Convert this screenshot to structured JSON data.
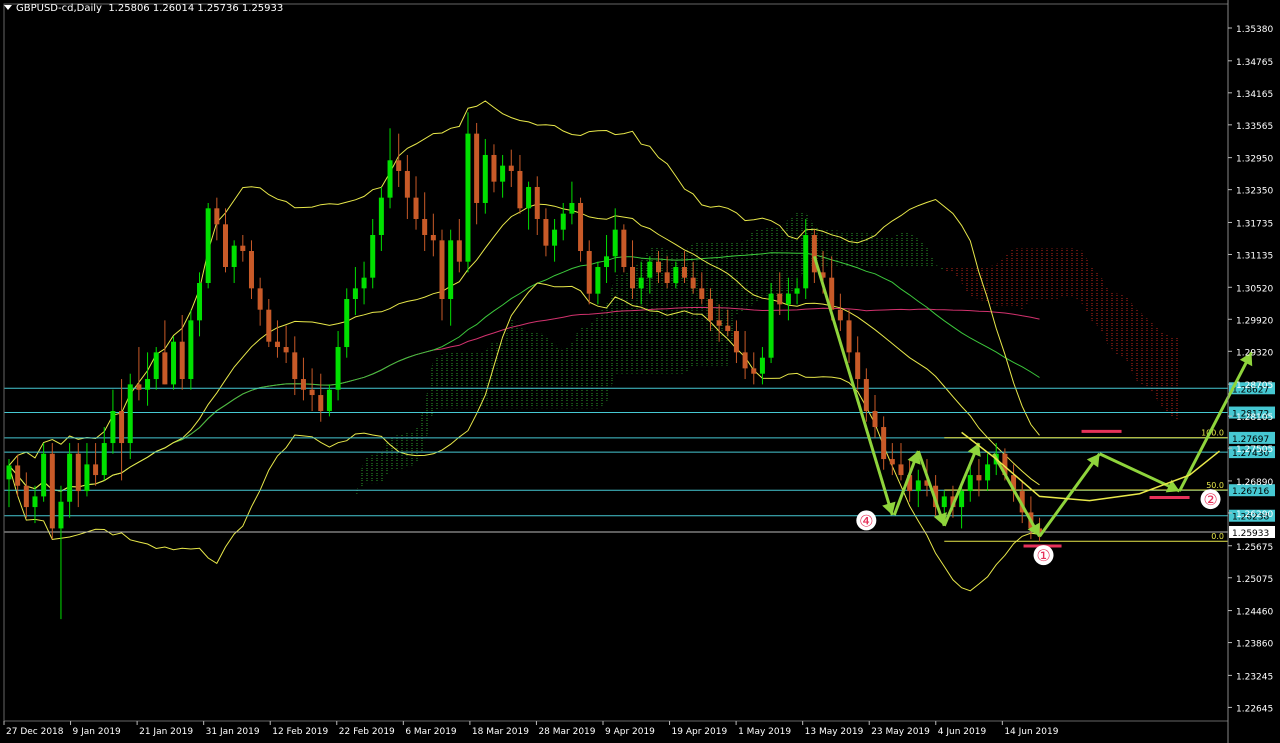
{
  "header": {
    "symbol": "GBPUSD-cd,Daily",
    "ohlc": "1.25806 1.26014 1.25736 1.25933"
  },
  "colors": {
    "background": "#000000",
    "bull_candle": "#00e000",
    "bear_candle": "#c85a28",
    "bollinger": "#e8e84a",
    "kumo_bear": "#c0281e",
    "kumo_bull": "#2ea02e",
    "ma_slow": "#d2326e",
    "ma_fast": "#3cc83c",
    "hline": "#46c8d2",
    "arrow": "#8fd43c",
    "marker": "#e6325a"
  },
  "chart_data": {
    "type": "candlestick",
    "ylim": [
      1.2239,
      1.3568
    ],
    "y_ticks": [
      "1.35380",
      "1.34765",
      "1.34165",
      "1.33565",
      "1.32950",
      "1.32350",
      "1.31735",
      "1.31135",
      "1.30520",
      "1.29920",
      "1.29320",
      "1.28705",
      "1.28105",
      "1.27505",
      "1.26890",
      "1.26290",
      "1.25675",
      "1.25075",
      "1.24460",
      "1.23860",
      "1.23245",
      "1.22645"
    ],
    "x_labels": [
      "27 Dec 2018",
      "9 Jan 2019",
      "21 Jan 2019",
      "31 Jan 2019",
      "12 Feb 2019",
      "22 Feb 2019",
      "6 Mar 2019",
      "18 Mar 2019",
      "28 Mar 2019",
      "9 Apr 2019",
      "19 Apr 2019",
      "1 May 2019",
      "13 May 2019",
      "23 May 2019",
      "4 Jun 2019",
      "14 Jun 2019"
    ],
    "price_levels": [
      "1.28627",
      "1.28172",
      "1.27697",
      "1.27430",
      "1.26716",
      "1.26238",
      "1.25933"
    ],
    "current_price": "1.25933",
    "fib_levels": [
      {
        "label": "100.0",
        "price": 1.277
      },
      {
        "label": "50.0",
        "price": 1.2672
      },
      {
        "label": "0.0",
        "price": 1.2576
      }
    ],
    "wave_labels": [
      "④",
      "①",
      "②"
    ],
    "candles": [
      [
        1.2692,
        1.273,
        1.264,
        1.2718
      ],
      [
        1.2718,
        1.2738,
        1.266,
        1.268
      ],
      [
        1.268,
        1.2705,
        1.262,
        1.264
      ],
      [
        1.264,
        1.268,
        1.261,
        1.266
      ],
      [
        1.266,
        1.276,
        1.265,
        1.274
      ],
      [
        1.274,
        1.276,
        1.258,
        1.26
      ],
      [
        1.26,
        1.268,
        1.243,
        1.265
      ],
      [
        1.265,
        1.276,
        1.262,
        1.274
      ],
      [
        1.274,
        1.276,
        1.264,
        1.267
      ],
      [
        1.267,
        1.276,
        1.266,
        1.272
      ],
      [
        1.272,
        1.276,
        1.268,
        1.27
      ],
      [
        1.27,
        1.279,
        1.269,
        1.276
      ],
      [
        1.276,
        1.286,
        1.274,
        1.282
      ],
      [
        1.282,
        1.288,
        1.269,
        1.276
      ],
      [
        1.276,
        1.289,
        1.273,
        1.287
      ],
      [
        1.287,
        1.294,
        1.284,
        1.286
      ],
      [
        1.286,
        1.293,
        1.283,
        1.288
      ],
      [
        1.288,
        1.294,
        1.286,
        1.293
      ],
      [
        1.293,
        1.299,
        1.287,
        1.287
      ],
      [
        1.287,
        1.296,
        1.286,
        1.295
      ],
      [
        1.295,
        1.3,
        1.286,
        1.288
      ],
      [
        1.288,
        1.301,
        1.286,
        1.299
      ],
      [
        1.299,
        1.308,
        1.296,
        1.306
      ],
      [
        1.306,
        1.321,
        1.305,
        1.32
      ],
      [
        1.32,
        1.322,
        1.314,
        1.317
      ],
      [
        1.317,
        1.32,
        1.308,
        1.309
      ],
      [
        1.309,
        1.314,
        1.306,
        1.313
      ],
      [
        1.313,
        1.315,
        1.31,
        1.312
      ],
      [
        1.312,
        1.314,
        1.303,
        1.305
      ],
      [
        1.305,
        1.307,
        1.298,
        1.301
      ],
      [
        1.301,
        1.303,
        1.294,
        1.295
      ],
      [
        1.295,
        1.299,
        1.292,
        1.294
      ],
      [
        1.294,
        1.298,
        1.291,
        1.293
      ],
      [
        1.293,
        1.296,
        1.285,
        1.288
      ],
      [
        1.288,
        1.292,
        1.284,
        1.286
      ],
      [
        1.286,
        1.29,
        1.282,
        1.285
      ],
      [
        1.285,
        1.289,
        1.28,
        1.282
      ],
      [
        1.282,
        1.287,
        1.281,
        1.286
      ],
      [
        1.286,
        1.297,
        1.284,
        1.294
      ],
      [
        1.294,
        1.305,
        1.292,
        1.303
      ],
      [
        1.303,
        1.309,
        1.3,
        1.305
      ],
      [
        1.305,
        1.31,
        1.302,
        1.307
      ],
      [
        1.307,
        1.318,
        1.305,
        1.315
      ],
      [
        1.315,
        1.324,
        1.312,
        1.322
      ],
      [
        1.322,
        1.335,
        1.32,
        1.329
      ],
      [
        1.329,
        1.334,
        1.324,
        1.327
      ],
      [
        1.327,
        1.33,
        1.318,
        1.322
      ],
      [
        1.322,
        1.326,
        1.316,
        1.318
      ],
      [
        1.318,
        1.323,
        1.312,
        1.315
      ],
      [
        1.315,
        1.319,
        1.311,
        1.314
      ],
      [
        1.314,
        1.316,
        1.299,
        1.303
      ],
      [
        1.303,
        1.316,
        1.298,
        1.314
      ],
      [
        1.314,
        1.318,
        1.308,
        1.31
      ],
      [
        1.31,
        1.338,
        1.308,
        1.334
      ],
      [
        1.334,
        1.336,
        1.317,
        1.321
      ],
      [
        1.321,
        1.333,
        1.319,
        1.33
      ],
      [
        1.33,
        1.332,
        1.323,
        1.325
      ],
      [
        1.325,
        1.33,
        1.322,
        1.328
      ],
      [
        1.328,
        1.331,
        1.324,
        1.327
      ],
      [
        1.327,
        1.33,
        1.319,
        1.32
      ],
      [
        1.32,
        1.325,
        1.316,
        1.324
      ],
      [
        1.324,
        1.326,
        1.315,
        1.318
      ],
      [
        1.318,
        1.32,
        1.311,
        1.313
      ],
      [
        1.313,
        1.318,
        1.31,
        1.316
      ],
      [
        1.316,
        1.321,
        1.314,
        1.319
      ],
      [
        1.319,
        1.325,
        1.317,
        1.321
      ],
      [
        1.321,
        1.322,
        1.31,
        1.312
      ],
      [
        1.312,
        1.314,
        1.302,
        1.304
      ],
      [
        1.304,
        1.31,
        1.302,
        1.309
      ],
      [
        1.309,
        1.315,
        1.306,
        1.311
      ],
      [
        1.311,
        1.32,
        1.308,
        1.316
      ],
      [
        1.316,
        1.317,
        1.308,
        1.309
      ],
      [
        1.309,
        1.314,
        1.303,
        1.305
      ],
      [
        1.305,
        1.31,
        1.302,
        1.307
      ],
      [
        1.307,
        1.311,
        1.304,
        1.31
      ],
      [
        1.31,
        1.312,
        1.306,
        1.308
      ],
      [
        1.308,
        1.311,
        1.305,
        1.306
      ],
      [
        1.306,
        1.31,
        1.305,
        1.309
      ],
      [
        1.309,
        1.312,
        1.306,
        1.307
      ],
      [
        1.307,
        1.31,
        1.304,
        1.305
      ],
      [
        1.305,
        1.308,
        1.302,
        1.303
      ],
      [
        1.303,
        1.305,
        1.297,
        1.299
      ],
      [
        1.299,
        1.302,
        1.295,
        1.298
      ],
      [
        1.298,
        1.301,
        1.296,
        1.297
      ],
      [
        1.297,
        1.299,
        1.291,
        1.293
      ],
      [
        1.293,
        1.297,
        1.288,
        1.29
      ],
      [
        1.29,
        1.293,
        1.287,
        1.289
      ],
      [
        1.289,
        1.294,
        1.287,
        1.292
      ],
      [
        1.292,
        1.306,
        1.291,
        1.304
      ],
      [
        1.304,
        1.308,
        1.3,
        1.302
      ],
      [
        1.302,
        1.307,
        1.299,
        1.304
      ],
      [
        1.304,
        1.307,
        1.302,
        1.305
      ],
      [
        1.305,
        1.318,
        1.303,
        1.315
      ],
      [
        1.315,
        1.316,
        1.306,
        1.308
      ],
      [
        1.308,
        1.312,
        1.304,
        1.307
      ],
      [
        1.307,
        1.311,
        1.299,
        1.301
      ],
      [
        1.301,
        1.304,
        1.297,
        1.299
      ],
      [
        1.299,
        1.301,
        1.291,
        1.293
      ],
      [
        1.293,
        1.296,
        1.286,
        1.288
      ],
      [
        1.288,
        1.29,
        1.28,
        1.282
      ],
      [
        1.282,
        1.285,
        1.277,
        1.279
      ],
      [
        1.279,
        1.281,
        1.271,
        1.273
      ],
      [
        1.273,
        1.276,
        1.27,
        1.272
      ],
      [
        1.272,
        1.276,
        1.269,
        1.27
      ],
      [
        1.27,
        1.273,
        1.265,
        1.267
      ],
      [
        1.267,
        1.271,
        1.264,
        1.269
      ],
      [
        1.269,
        1.273,
        1.266,
        1.268
      ],
      [
        1.268,
        1.27,
        1.262,
        1.264
      ],
      [
        1.264,
        1.267,
        1.261,
        1.266
      ],
      [
        1.266,
        1.268,
        1.262,
        1.264
      ],
      [
        1.264,
        1.268,
        1.26,
        1.267
      ],
      [
        1.267,
        1.272,
        1.265,
        1.27
      ],
      [
        1.27,
        1.273,
        1.266,
        1.269
      ],
      [
        1.269,
        1.274,
        1.267,
        1.272
      ],
      [
        1.272,
        1.276,
        1.27,
        1.274
      ],
      [
        1.274,
        1.275,
        1.269,
        1.27
      ],
      [
        1.27,
        1.272,
        1.265,
        1.267
      ],
      [
        1.267,
        1.269,
        1.261,
        1.263
      ],
      [
        1.263,
        1.266,
        1.258,
        1.26
      ],
      [
        1.26,
        1.262,
        1.2575,
        1.2593
      ]
    ]
  }
}
